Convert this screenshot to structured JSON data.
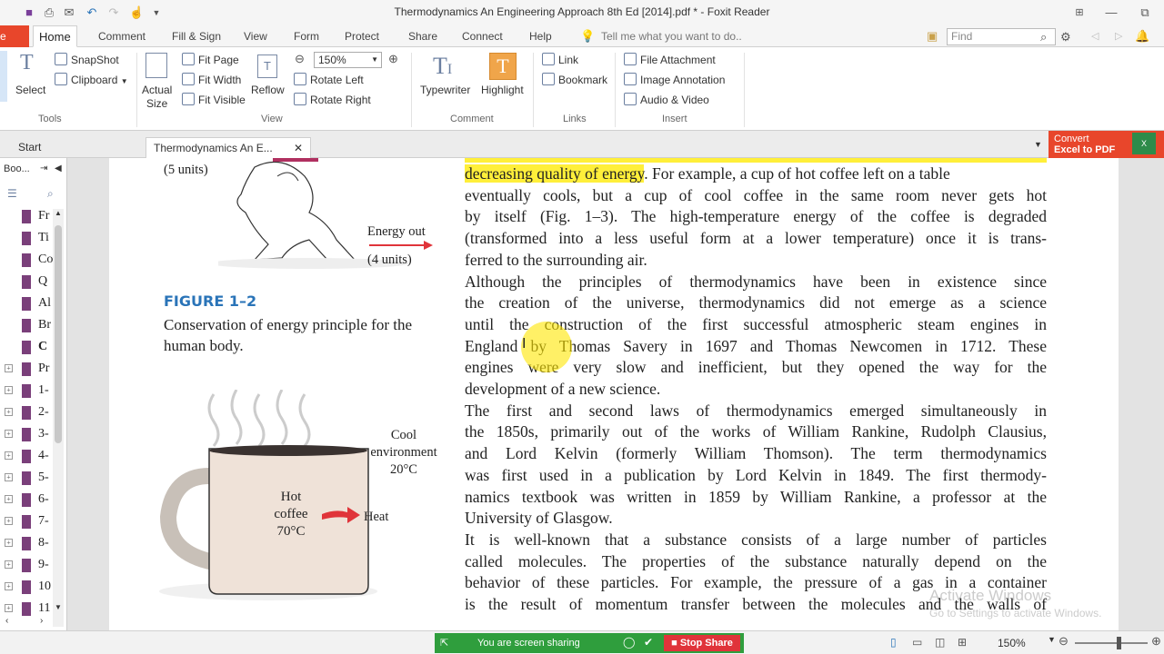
{
  "window": {
    "title": "Thermodynamics An Engineering Approach 8th Ed [2014].pdf * - Foxit Reader"
  },
  "menu": {
    "file_label": "e",
    "tabs": [
      "Home",
      "Comment",
      "Fill & Sign",
      "View",
      "Form",
      "Protect",
      "Share",
      "Connect",
      "Help"
    ],
    "tell_me_placeholder": "Tell me what you want to do..",
    "find_placeholder": "Find"
  },
  "ribbon": {
    "select_label": "Select",
    "snapshot_label": "SnapShot",
    "clipboard_label": "Clipboard",
    "tools_group": "Tools",
    "actual_size_label": "Actual\nSize",
    "fit_page_label": "Fit Page",
    "fit_width_label": "Fit Width",
    "fit_visible_label": "Fit Visible",
    "reflow_label": "Reflow",
    "zoom_value": "150%",
    "rotate_left_label": "Rotate Left",
    "rotate_right_label": "Rotate Right",
    "view_group": "View",
    "typewriter_label": "Typewriter",
    "highlight_label": "Highlight",
    "comment_group": "Comment",
    "link_label": "Link",
    "bookmark_label": "Bookmark",
    "links_group": "Links",
    "file_attachment_label": "File Attachment",
    "image_annotation_label": "Image Annotation",
    "audio_video_label": "Audio & Video",
    "insert_group": "Insert"
  },
  "tabs": {
    "start": "Start",
    "document": "Thermodynamics An E...",
    "convert_line1": "Convert",
    "convert_line2": "Excel to PDF"
  },
  "bookmarks": {
    "header": "Boo...",
    "items": [
      {
        "label": "Fr",
        "expandable": false
      },
      {
        "label": "Ti",
        "expandable": false
      },
      {
        "label": "Co",
        "expandable": false
      },
      {
        "label": "Q",
        "expandable": false
      },
      {
        "label": "Al",
        "expandable": false
      },
      {
        "label": "Br",
        "expandable": false
      },
      {
        "label": "C",
        "expandable": false
      },
      {
        "label": "Pr",
        "expandable": true
      },
      {
        "label": "1-",
        "expandable": true
      },
      {
        "label": "2-",
        "expandable": true
      },
      {
        "label": "3-",
        "expandable": true
      },
      {
        "label": "4-",
        "expandable": true
      },
      {
        "label": "5-",
        "expandable": true
      },
      {
        "label": "6-",
        "expandable": true
      },
      {
        "label": "7-",
        "expandable": true
      },
      {
        "label": "8-",
        "expandable": true
      },
      {
        "label": "9-",
        "expandable": true
      },
      {
        "label": "10",
        "expandable": true
      },
      {
        "label": "11",
        "expandable": true
      }
    ]
  },
  "document": {
    "figure_top_label_units": "(5 units)",
    "energy_out_label": "Energy out",
    "energy_out_units": "(4 units)",
    "figure_title": "FIGURE 1–2",
    "figure_caption": "Conservation of energy principle for the human body.",
    "cup_label_line1": "Hot",
    "cup_label_line2": "coffee",
    "cup_label_line3": "70°C",
    "cool_env_line1": "Cool",
    "cool_env_line2": "environment",
    "cool_env_line3": "20°C",
    "heat_label": "Heat",
    "lines": [
      {
        "text": "decreasing quality of energy",
        "rest": ". For example, a cup of hot coffee left on a table",
        "highlight": true
      },
      {
        "text": "eventually cools, but a cup of cool coffee in the same room never gets hot"
      },
      {
        "text": "by itself (Fig. 1–3). The high-temperature energy of the coffee is degraded"
      },
      {
        "text": "(transformed into a less useful form at a lower temperature) once it is trans-"
      },
      {
        "text": "ferred to the surrounding air.",
        "last": true
      },
      {
        "text": "   Although the principles of thermodynamics have been in existence since"
      },
      {
        "text": "the creation of the universe, thermodynamics did not emerge as a science"
      },
      {
        "text": "until the construction of the first successful atmospheric steam engines in"
      },
      {
        "text": "England by Thomas Savery in 1697 and Thomas Newcomen in 1712. These"
      },
      {
        "text": "engines were very slow and inefficient, but they opened the way for the"
      },
      {
        "text": "development of a new science.",
        "last": true
      },
      {
        "text": "   The first and second laws of thermodynamics emerged simultaneously in"
      },
      {
        "text": "the 1850s, primarily out of the works of William Rankine, Rudolph Clausius,"
      },
      {
        "text": "and Lord Kelvin (formerly William Thomson). The term thermodynamics"
      },
      {
        "text": "was first used in a publication by Lord Kelvin in 1849. The first thermody-"
      },
      {
        "text": "namics textbook was written in 1859 by William Rankine, a professor at the"
      },
      {
        "text": "University of Glasgow.",
        "last": true
      },
      {
        "text": "   It is well-known that a substance consists of a large number of particles"
      },
      {
        "text": "called molecules. The properties of the substance naturally depend on the"
      },
      {
        "text": "behavior of these particles. For example, the pressure of a gas in a container"
      },
      {
        "text": "is the result of momentum transfer between the molecules and the walls of"
      }
    ]
  },
  "status": {
    "screen_sharing": "You are screen sharing",
    "stop_share": "Stop Share",
    "zoom": "150%",
    "watermark_line1": "Activate Windows",
    "watermark_line2": "Go to Settings to activate Windows."
  },
  "colors": {
    "accent": "#e8462b",
    "highlight": "#ffef3a",
    "figure_blue": "#2a74b8",
    "share_green": "#2f9e3d",
    "stop_red": "#e0343a"
  }
}
